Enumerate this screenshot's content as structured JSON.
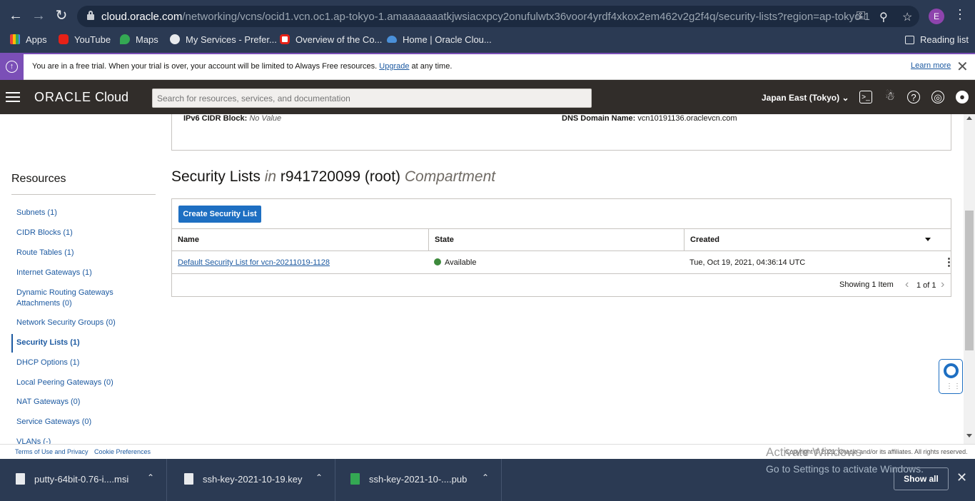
{
  "browser": {
    "url_host": "cloud.oracle.com",
    "url_path": "/networking/vcns/ocid1.vcn.oc1.ap-tokyo-1.amaaaaaaatkjwsiacxpcy2onufulwtx36voor4yrdf4xkox2em462v2g2f4q/security-lists?region=ap-tokyo-1",
    "profile_initial": "E",
    "bookmarks": [
      "Apps",
      "YouTube",
      "Maps",
      "My Services - Prefer...",
      "Overview of the Co...",
      "Home | Oracle Clou..."
    ],
    "reading_list": "Reading list"
  },
  "trial_banner": {
    "text_before": "You are in a free trial. When your trial is over, your account will be limited to Always Free resources. ",
    "upgrade_link": "Upgrade",
    "text_after": " at any time.",
    "learn_more": "Learn more"
  },
  "header": {
    "brand": "ORACLE",
    "brand_suffix": " Cloud",
    "search_placeholder": "Search for resources, services, and documentation",
    "region": "Japan East (Tokyo)"
  },
  "vcn_details": {
    "ipv6_label": "IPv6 CIDR Block:",
    "ipv6_value": "No Value",
    "dns_label": "DNS Domain Name:",
    "dns_value": "vcn10191136.oraclevcn.com"
  },
  "sidebar": {
    "heading": "Resources",
    "items": [
      "Subnets (1)",
      "CIDR Blocks (1)",
      "Route Tables (1)",
      "Internet Gateways (1)",
      "Dynamic Routing Gateways Attachments (0)",
      "Network Security Groups (0)",
      "Security Lists (1)",
      "DHCP Options (1)",
      "Local Peering Gateways (0)",
      "NAT Gateways (0)",
      "Service Gateways (0)",
      "VLANs (-)"
    ]
  },
  "page": {
    "title": "Security Lists",
    "in": "in",
    "compartment": "r941720099 (root)",
    "compartment_suffix": "Compartment",
    "create_button": "Create Security List"
  },
  "table": {
    "columns": [
      "Name",
      "State",
      "Created"
    ],
    "rows": [
      {
        "name": "Default Security List for vcn-20211019-1128",
        "state": "Available",
        "created": "Tue, Oct 19, 2021, 04:36:14 UTC"
      }
    ],
    "showing": "Showing 1 Item",
    "pagination": "1 of 1"
  },
  "footer": {
    "terms": "Terms of Use and Privacy",
    "cookies": "Cookie Preferences",
    "copyright": "Copyright © 2021, Oracle and/or its affiliates. All rights reserved.",
    "watermark_title": "Activate Windows",
    "watermark_sub": "Go to Settings to activate Windows."
  },
  "downloads": {
    "items": [
      "putty-64bit-0.76-i....msi",
      "ssh-key-2021-10-19.key",
      "ssh-key-2021-10-....pub"
    ],
    "show_all": "Show all"
  },
  "colors": {
    "accent": "#1e6fc2",
    "link": "#1d5aa1",
    "header_bg": "#312d2a",
    "status_available": "#3d8a3c",
    "trial_purple": "#7b4fb7"
  }
}
